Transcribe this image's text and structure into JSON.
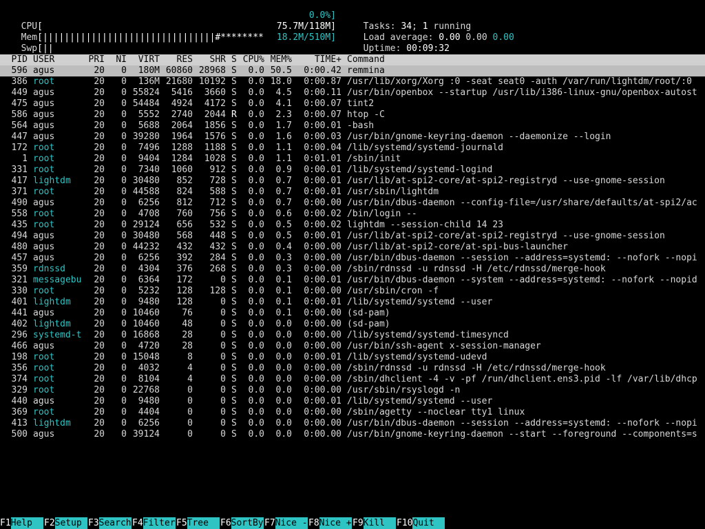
{
  "meters": {
    "cpu": {
      "label": "CPU",
      "bar": "[",
      "value": "0.0%]"
    },
    "mem": {
      "label": "Mem",
      "bar": "[||||||||||||||||||||||||||||||||#********",
      "value": "75.7M/118M]"
    },
    "swp": {
      "label": "Swp",
      "bar": "[||",
      "value": "18.2M/510M]"
    }
  },
  "stats": {
    "tasks_label": "Tasks: ",
    "tasks_value": "34",
    "tasks_sep": "; ",
    "running_value": "1",
    "running_label": " running",
    "load_label": "Load average: ",
    "load1": "0.00",
    "load5": "0.00",
    "load15": "0.00",
    "uptime_label": "Uptime: ",
    "uptime_value": "00:09:32"
  },
  "columns": [
    "PID",
    "USER",
    "PRI",
    "NI",
    "VIRT",
    "RES",
    "SHR",
    "S",
    "CPU%",
    "MEM%",
    "TIME+",
    "Command"
  ],
  "processes": [
    {
      "pid": "596",
      "user": "agus",
      "pri": "20",
      "ni": "0",
      "virt": "180M",
      "res": "60860",
      "shr": "28968",
      "s": "S",
      "cpu": "0.0",
      "mem": "50.5",
      "time": "0:00.42",
      "cmd": "remmina"
    },
    {
      "pid": "386",
      "user": "root",
      "pri": "20",
      "ni": "0",
      "virt": "136M",
      "res": "21680",
      "shr": "10192",
      "s": "S",
      "cpu": "0.0",
      "mem": "18.0",
      "time": "0:00.87",
      "cmd": "/usr/lib/xorg/Xorg :0 -seat seat0 -auth /var/run/lightdm/root/:0"
    },
    {
      "pid": "449",
      "user": "agus",
      "pri": "20",
      "ni": "0",
      "virt": "55824",
      "res": "5416",
      "shr": "3660",
      "s": "S",
      "cpu": "0.0",
      "mem": "4.5",
      "time": "0:00.11",
      "cmd": "/usr/bin/openbox --startup /usr/lib/i386-linux-gnu/openbox-autost"
    },
    {
      "pid": "475",
      "user": "agus",
      "pri": "20",
      "ni": "0",
      "virt": "54484",
      "res": "4924",
      "shr": "4172",
      "s": "S",
      "cpu": "0.0",
      "mem": "4.1",
      "time": "0:00.07",
      "cmd": "tint2"
    },
    {
      "pid": "586",
      "user": "agus",
      "pri": "20",
      "ni": "0",
      "virt": "5552",
      "res": "2740",
      "shr": "2044",
      "s": "R",
      "cpu": "0.0",
      "mem": "2.3",
      "time": "0:00.07",
      "cmd": "htop -C"
    },
    {
      "pid": "564",
      "user": "agus",
      "pri": "20",
      "ni": "0",
      "virt": "5688",
      "res": "2064",
      "shr": "1856",
      "s": "S",
      "cpu": "0.0",
      "mem": "1.7",
      "time": "0:00.01",
      "cmd": "-bash"
    },
    {
      "pid": "447",
      "user": "agus",
      "pri": "20",
      "ni": "0",
      "virt": "39280",
      "res": "1964",
      "shr": "1576",
      "s": "S",
      "cpu": "0.0",
      "mem": "1.6",
      "time": "0:00.03",
      "cmd": "/usr/bin/gnome-keyring-daemon --daemonize --login"
    },
    {
      "pid": "172",
      "user": "root",
      "pri": "20",
      "ni": "0",
      "virt": "7496",
      "res": "1288",
      "shr": "1188",
      "s": "S",
      "cpu": "0.0",
      "mem": "1.1",
      "time": "0:00.04",
      "cmd": "/lib/systemd/systemd-journald"
    },
    {
      "pid": "1",
      "user": "root",
      "pri": "20",
      "ni": "0",
      "virt": "9404",
      "res": "1284",
      "shr": "1028",
      "s": "S",
      "cpu": "0.0",
      "mem": "1.1",
      "time": "0:01.01",
      "cmd": "/sbin/init"
    },
    {
      "pid": "331",
      "user": "root",
      "pri": "20",
      "ni": "0",
      "virt": "7340",
      "res": "1060",
      "shr": "912",
      "s": "S",
      "cpu": "0.0",
      "mem": "0.9",
      "time": "0:00.01",
      "cmd": "/lib/systemd/systemd-logind"
    },
    {
      "pid": "417",
      "user": "lightdm",
      "pri": "20",
      "ni": "0",
      "virt": "30480",
      "res": "852",
      "shr": "728",
      "s": "S",
      "cpu": "0.0",
      "mem": "0.7",
      "time": "0:00.01",
      "cmd": "/usr/lib/at-spi2-core/at-spi2-registryd --use-gnome-session"
    },
    {
      "pid": "371",
      "user": "root",
      "pri": "20",
      "ni": "0",
      "virt": "44588",
      "res": "824",
      "shr": "588",
      "s": "S",
      "cpu": "0.0",
      "mem": "0.7",
      "time": "0:00.01",
      "cmd": "/usr/sbin/lightdm"
    },
    {
      "pid": "490",
      "user": "agus",
      "pri": "20",
      "ni": "0",
      "virt": "6256",
      "res": "812",
      "shr": "712",
      "s": "S",
      "cpu": "0.0",
      "mem": "0.7",
      "time": "0:00.00",
      "cmd": "/usr/bin/dbus-daemon --config-file=/usr/share/defaults/at-spi2/ac"
    },
    {
      "pid": "558",
      "user": "root",
      "pri": "20",
      "ni": "0",
      "virt": "4708",
      "res": "760",
      "shr": "756",
      "s": "S",
      "cpu": "0.0",
      "mem": "0.6",
      "time": "0:00.02",
      "cmd": "/bin/login --"
    },
    {
      "pid": "435",
      "user": "root",
      "pri": "20",
      "ni": "0",
      "virt": "29124",
      "res": "656",
      "shr": "532",
      "s": "S",
      "cpu": "0.0",
      "mem": "0.5",
      "time": "0:00.02",
      "cmd": "lightdm --session-child 14 23"
    },
    {
      "pid": "494",
      "user": "agus",
      "pri": "20",
      "ni": "0",
      "virt": "30480",
      "res": "568",
      "shr": "448",
      "s": "S",
      "cpu": "0.0",
      "mem": "0.5",
      "time": "0:00.01",
      "cmd": "/usr/lib/at-spi2-core/at-spi2-registryd --use-gnome-session"
    },
    {
      "pid": "480",
      "user": "agus",
      "pri": "20",
      "ni": "0",
      "virt": "44232",
      "res": "432",
      "shr": "432",
      "s": "S",
      "cpu": "0.0",
      "mem": "0.4",
      "time": "0:00.00",
      "cmd": "/usr/lib/at-spi2-core/at-spi-bus-launcher"
    },
    {
      "pid": "457",
      "user": "agus",
      "pri": "20",
      "ni": "0",
      "virt": "6256",
      "res": "392",
      "shr": "284",
      "s": "S",
      "cpu": "0.0",
      "mem": "0.3",
      "time": "0:00.00",
      "cmd": "/usr/bin/dbus-daemon --session --address=systemd: --nofork --nopi"
    },
    {
      "pid": "359",
      "user": "rdnssd",
      "pri": "20",
      "ni": "0",
      "virt": "4304",
      "res": "376",
      "shr": "268",
      "s": "S",
      "cpu": "0.0",
      "mem": "0.3",
      "time": "0:00.00",
      "cmd": "/sbin/rdnssd -u rdnssd -H /etc/rdnssd/merge-hook"
    },
    {
      "pid": "321",
      "user": "messagebu",
      "pri": "20",
      "ni": "0",
      "virt": "6364",
      "res": "172",
      "shr": "0",
      "s": "S",
      "cpu": "0.0",
      "mem": "0.1",
      "time": "0:00.01",
      "cmd": "/usr/bin/dbus-daemon --system --address=systemd: --nofork --nopid"
    },
    {
      "pid": "330",
      "user": "root",
      "pri": "20",
      "ni": "0",
      "virt": "5232",
      "res": "128",
      "shr": "128",
      "s": "S",
      "cpu": "0.0",
      "mem": "0.1",
      "time": "0:00.00",
      "cmd": "/usr/sbin/cron -f"
    },
    {
      "pid": "401",
      "user": "lightdm",
      "pri": "20",
      "ni": "0",
      "virt": "9480",
      "res": "128",
      "shr": "0",
      "s": "S",
      "cpu": "0.0",
      "mem": "0.1",
      "time": "0:00.01",
      "cmd": "/lib/systemd/systemd --user"
    },
    {
      "pid": "441",
      "user": "agus",
      "pri": "20",
      "ni": "0",
      "virt": "10460",
      "res": "76",
      "shr": "0",
      "s": "S",
      "cpu": "0.0",
      "mem": "0.1",
      "time": "0:00.00",
      "cmd": "(sd-pam)"
    },
    {
      "pid": "402",
      "user": "lightdm",
      "pri": "20",
      "ni": "0",
      "virt": "10460",
      "res": "48",
      "shr": "0",
      "s": "S",
      "cpu": "0.0",
      "mem": "0.0",
      "time": "0:00.00",
      "cmd": "(sd-pam)"
    },
    {
      "pid": "296",
      "user": "systemd-t",
      "pri": "20",
      "ni": "0",
      "virt": "16868",
      "res": "28",
      "shr": "0",
      "s": "S",
      "cpu": "0.0",
      "mem": "0.0",
      "time": "0:00.00",
      "cmd": "/lib/systemd/systemd-timesyncd"
    },
    {
      "pid": "466",
      "user": "agus",
      "pri": "20",
      "ni": "0",
      "virt": "4720",
      "res": "28",
      "shr": "0",
      "s": "S",
      "cpu": "0.0",
      "mem": "0.0",
      "time": "0:00.00",
      "cmd": "/usr/bin/ssh-agent x-session-manager"
    },
    {
      "pid": "198",
      "user": "root",
      "pri": "20",
      "ni": "0",
      "virt": "15048",
      "res": "8",
      "shr": "0",
      "s": "S",
      "cpu": "0.0",
      "mem": "0.0",
      "time": "0:00.01",
      "cmd": "/lib/systemd/systemd-udevd"
    },
    {
      "pid": "356",
      "user": "root",
      "pri": "20",
      "ni": "0",
      "virt": "4032",
      "res": "4",
      "shr": "0",
      "s": "S",
      "cpu": "0.0",
      "mem": "0.0",
      "time": "0:00.00",
      "cmd": "/sbin/rdnssd -u rdnssd -H /etc/rdnssd/merge-hook"
    },
    {
      "pid": "374",
      "user": "root",
      "pri": "20",
      "ni": "0",
      "virt": "8104",
      "res": "4",
      "shr": "0",
      "s": "S",
      "cpu": "0.0",
      "mem": "0.0",
      "time": "0:00.00",
      "cmd": "/sbin/dhclient -4 -v -pf /run/dhclient.ens3.pid -lf /var/lib/dhcp"
    },
    {
      "pid": "329",
      "user": "root",
      "pri": "20",
      "ni": "0",
      "virt": "22768",
      "res": "0",
      "shr": "0",
      "s": "S",
      "cpu": "0.0",
      "mem": "0.0",
      "time": "0:00.00",
      "cmd": "/usr/sbin/rsyslogd -n"
    },
    {
      "pid": "440",
      "user": "agus",
      "pri": "20",
      "ni": "0",
      "virt": "9480",
      "res": "0",
      "shr": "0",
      "s": "S",
      "cpu": "0.0",
      "mem": "0.0",
      "time": "0:00.01",
      "cmd": "/lib/systemd/systemd --user"
    },
    {
      "pid": "369",
      "user": "root",
      "pri": "20",
      "ni": "0",
      "virt": "4404",
      "res": "0",
      "shr": "0",
      "s": "S",
      "cpu": "0.0",
      "mem": "0.0",
      "time": "0:00.00",
      "cmd": "/sbin/agetty --noclear tty1 linux"
    },
    {
      "pid": "413",
      "user": "lightdm",
      "pri": "20",
      "ni": "0",
      "virt": "6256",
      "res": "0",
      "shr": "0",
      "s": "S",
      "cpu": "0.0",
      "mem": "0.0",
      "time": "0:00.00",
      "cmd": "/usr/bin/dbus-daemon --session --address=systemd: --nofork --nopi"
    },
    {
      "pid": "500",
      "user": "agus",
      "pri": "20",
      "ni": "0",
      "virt": "39124",
      "res": "0",
      "shr": "0",
      "s": "S",
      "cpu": "0.0",
      "mem": "0.0",
      "time": "0:00.00",
      "cmd": "/usr/bin/gnome-keyring-daemon --start --foreground --components=s"
    }
  ],
  "fkeys": [
    {
      "key": "F1",
      "label": "Help  "
    },
    {
      "key": "F2",
      "label": "Setup "
    },
    {
      "key": "F3",
      "label": "Search"
    },
    {
      "key": "F4",
      "label": "Filter"
    },
    {
      "key": "F5",
      "label": "Tree  "
    },
    {
      "key": "F6",
      "label": "SortBy"
    },
    {
      "key": "F7",
      "label": "Nice -"
    },
    {
      "key": "F8",
      "label": "Nice +"
    },
    {
      "key": "F9",
      "label": "Kill  "
    },
    {
      "key": "F10",
      "label": "Quit  "
    }
  ],
  "colors": {
    "accent": "#2ec4c4",
    "header_bg": "#d0d0d0",
    "selected_bg": "#bdbdbd"
  }
}
